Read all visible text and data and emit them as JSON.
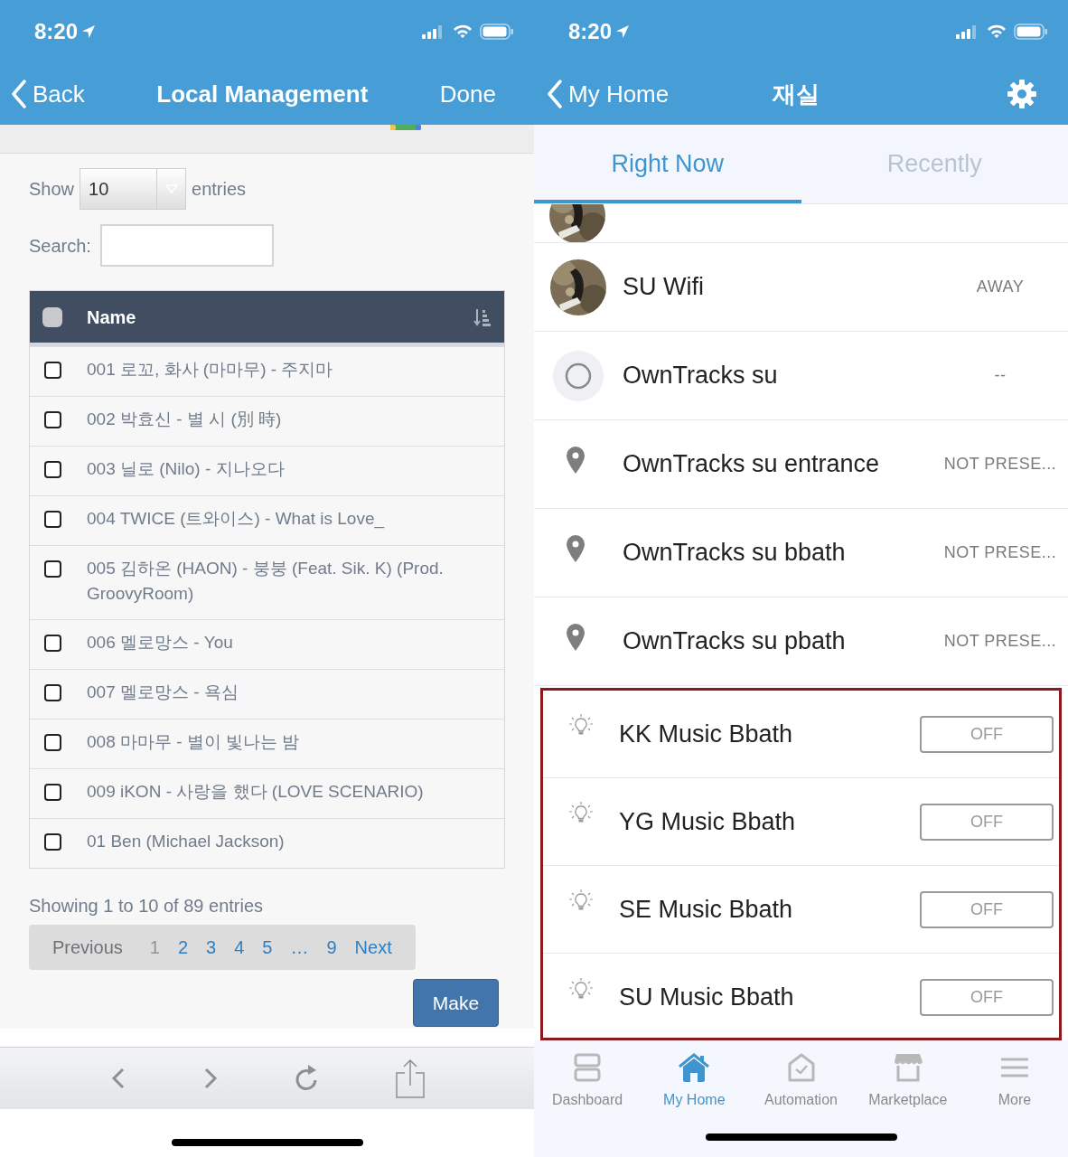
{
  "left": {
    "status_bar": {
      "time": "8:20"
    },
    "nav": {
      "back": "Back",
      "title": "Local Management",
      "action": "Done"
    },
    "length": {
      "before": "Show",
      "value": "10",
      "after": "entries"
    },
    "search": {
      "label": "Search:"
    },
    "table": {
      "header": "Name",
      "header_checked": false,
      "rows": [
        {
          "text": "001 로꼬, 화사 (마마무) - 주지마",
          "checked": false
        },
        {
          "text": "002 박효신 - 별 시 (別 時)",
          "checked": false
        },
        {
          "text": "003 닐로 (Nilo) - 지나오다",
          "checked": false
        },
        {
          "text": "004 TWICE (트와이스) - What is Love_",
          "checked": false
        },
        {
          "text": "005 김하온 (HAON) - 붕붕 (Feat. Sik. K) (Prod. GroovyRoom)",
          "checked": false
        },
        {
          "text": "006 멜로망스 - You",
          "checked": false
        },
        {
          "text": "007 멜로망스 - 욕심",
          "checked": false
        },
        {
          "text": "008 마마무 - 별이 빛나는 밤",
          "checked": false
        },
        {
          "text": "009 iKON - 사랑을 했다 (LOVE SCENARIO)",
          "checked": false
        },
        {
          "text": "01 Ben (Michael Jackson)",
          "checked": false
        }
      ]
    },
    "info": "Showing 1 to 10 of 89 entries",
    "pagination": [
      {
        "label": "Previous",
        "selected": false,
        "disabled": true
      },
      {
        "label": "1",
        "selected": true,
        "disabled": false
      },
      {
        "label": "2",
        "selected": false,
        "disabled": false
      },
      {
        "label": "3",
        "selected": false,
        "disabled": false
      },
      {
        "label": "4",
        "selected": false,
        "disabled": false
      },
      {
        "label": "5",
        "selected": false,
        "disabled": false
      },
      {
        "label": "…",
        "selected": false,
        "disabled": false
      },
      {
        "label": "9",
        "selected": false,
        "disabled": false
      },
      {
        "label": "Next",
        "selected": false,
        "disabled": false
      }
    ],
    "make_button": "Make"
  },
  "right": {
    "status_bar": {
      "time": "8:20"
    },
    "nav": {
      "back": "My Home",
      "title": "재실"
    },
    "tabs": [
      {
        "label": "Right Now",
        "selected": true
      },
      {
        "label": "Recently",
        "selected": false
      }
    ],
    "presence": [
      {
        "kind": "avatar",
        "name": "SU Wifi",
        "status": "AWAY"
      },
      {
        "kind": "circle",
        "name": "OwnTracks su",
        "status": "--"
      },
      {
        "kind": "pin",
        "name": "OwnTracks su entrance",
        "status": "NOT PRESE..."
      },
      {
        "kind": "pin",
        "name": "OwnTracks su bbath",
        "status": "NOT PRESE..."
      },
      {
        "kind": "pin",
        "name": "OwnTracks su pbath",
        "status": "NOT PRESE..."
      }
    ],
    "switches": [
      {
        "name": "KK Music Bbath",
        "state": "OFF"
      },
      {
        "name": "YG Music Bbath",
        "state": "OFF"
      },
      {
        "name": "SE Music Bbath",
        "state": "OFF"
      },
      {
        "name": "SU Music Bbath",
        "state": "OFF"
      }
    ],
    "tab_bar": [
      {
        "kind": "dashboard",
        "label": "Dashboard",
        "selected": false
      },
      {
        "kind": "home",
        "label": "My Home",
        "selected": true
      },
      {
        "kind": "automation",
        "label": "Automation",
        "selected": false
      },
      {
        "kind": "marketplace",
        "label": "Marketplace",
        "selected": false
      },
      {
        "kind": "more",
        "label": "More",
        "selected": false
      }
    ]
  }
}
